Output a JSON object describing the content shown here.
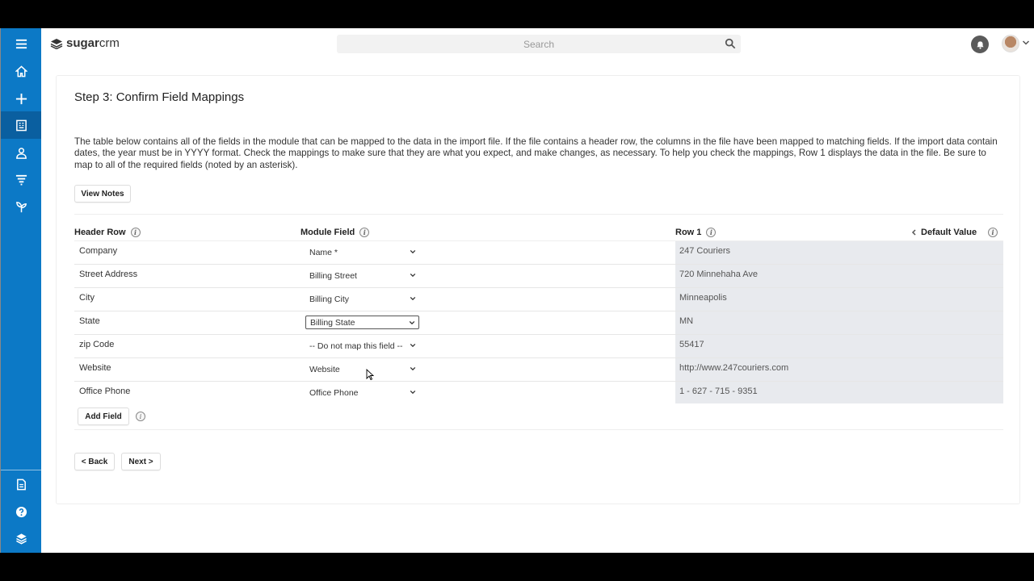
{
  "app": {
    "brand_bold": "sugar",
    "brand_rest": "crm"
  },
  "search": {
    "placeholder": "Search"
  },
  "sidebar": {
    "items": [
      {
        "icon": "menu-icon"
      },
      {
        "icon": "home-icon"
      },
      {
        "icon": "plus-icon"
      },
      {
        "icon": "accounts-icon"
      },
      {
        "icon": "contacts-icon"
      },
      {
        "icon": "leads-filter-icon"
      },
      {
        "icon": "opportunities-icon"
      },
      {
        "icon": "document-icon"
      },
      {
        "icon": "help-icon"
      },
      {
        "icon": "layers-icon"
      }
    ]
  },
  "page": {
    "title": "Step 3: Confirm Field Mappings",
    "description": "The table below contains all of the fields in the module that can be mapped to the data in the import file. If the file contains a header row, the columns in the file have been mapped to matching fields. If the import data contain dates, the year must be in YYYY format. Check the mappings to make sure that they are what you expect, and make changes, as necessary. To help you check the mappings, Row 1 displays the data in the file. Be sure to map to all of the required fields (noted by an asterisk).",
    "view_notes": "View Notes",
    "add_field": "Add Field",
    "back": "< Back",
    "next": "Next >"
  },
  "table": {
    "headers": {
      "header_row": "Header Row",
      "module_field": "Module Field",
      "row1": "Row 1",
      "default_value": "Default Value"
    },
    "info_glyph": "i",
    "rows": [
      {
        "header": "Company",
        "field": "Name *",
        "value": "247 Couriers"
      },
      {
        "header": "Street Address",
        "field": "Billing Street",
        "value": "720 Minnehaha Ave"
      },
      {
        "header": "City",
        "field": "Billing City",
        "value": "Minneapolis"
      },
      {
        "header": "State",
        "field": "Billing State",
        "value": "MN"
      },
      {
        "header": "zip Code",
        "field": "-- Do not map this field --",
        "value": "55417"
      },
      {
        "header": "Website",
        "field": "Website",
        "value": "http://www.247couriers.com"
      },
      {
        "header": "Office Phone",
        "field": "Office Phone",
        "value": "1 - 627 - 715 - 9351"
      }
    ]
  },
  "colors": {
    "sidebar": "#0c79c6",
    "sidebar_active": "#0a5fa0",
    "grey_column": "#e8eaee"
  }
}
